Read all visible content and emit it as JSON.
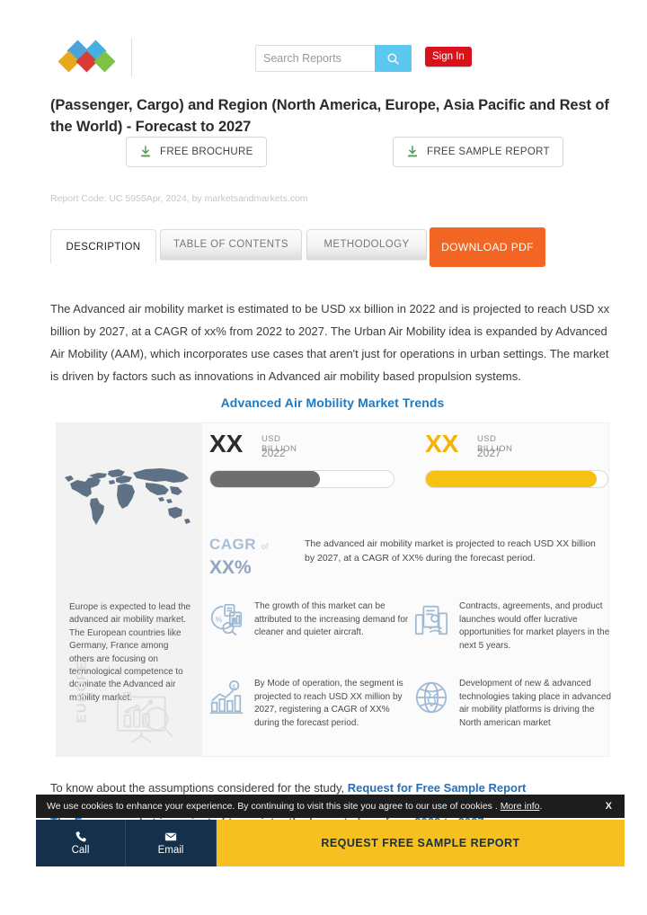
{
  "header": {
    "logo_name": "marketsandmarkets-logo",
    "logo_colors": [
      "#4aa3dd",
      "#45b0e3",
      "#e8a81c",
      "#d93b35",
      "#7dc242"
    ],
    "search": {
      "placeholder": "Search Reports",
      "value": "",
      "button_icon": "search-icon",
      "button_color": "#5bc8ef"
    },
    "sign_in_label": "Sign In",
    "sign_in_color": "#d9111a"
  },
  "title": "(Passenger, Cargo) and Region (North America, Europe, Asia Pacific and Rest of the World) - Forecast to 2027",
  "cta": {
    "brochure_label": "FREE BROCHURE",
    "sample_label": "FREE SAMPLE REPORT",
    "icon": "download-icon",
    "icon_color": "#4f9b52"
  },
  "meta_line": "Report Code: UC 5955Apr, 2024, by marketsandmarkets.com",
  "tabs": [
    {
      "label": "DESCRIPTION",
      "active": true
    },
    {
      "label": "TABLE OF CONTENTS",
      "active": false
    },
    {
      "label": "METHODOLOGY",
      "active": false
    }
  ],
  "download_pdf_label": "DOWNLOAD PDF",
  "download_pdf_color": "#f26522",
  "intro_paragraph": "The Advanced air mobility market is estimated to be USD xx billion in 2022 and is projected to reach USD xx billion by 2027, at a CAGR of xx% from 2022 to 2027. The Urban Air Mobility idea is expanded by Advanced Air Mobility (AAM), which incorporates use cases that aren't just for operations in urban settings. The market is driven by factors such as innovations in Advanced air mobility based propulsion systems.",
  "infographic": {
    "title": "Advanced Air Mobility Market Trends",
    "title_color": "#1f7ac0",
    "map_icon": "world-map-icon",
    "europe_note": "Europe is expected to lead the advanced air mobility market. The European countries like Germany, France among others are focusing on technological competence to dominate the Advanced air mobility market.",
    "europe_watermark": "EUROPE",
    "europe_icon": "chart-presentation-magnifier-icon",
    "figures": [
      {
        "value": "XX",
        "unit": "USD BILLION",
        "year": "2022",
        "bar_fill_percent": 60,
        "color": "#2c2c2c",
        "bar_color": "#6e6e6e"
      },
      {
        "value": "XX",
        "unit": "USD BILLION",
        "year": "2027",
        "bar_fill_percent": 94,
        "color": "#f5b301",
        "bar_color": "#f8c112"
      }
    ],
    "cagr": {
      "label": "CAGR",
      "of": "of",
      "value": "XX%",
      "text": "The advanced air mobility market is projected to reach USD XX billion by 2027, at a CAGR of XX% during the forecast period."
    },
    "cards": [
      {
        "icon": "pie-chart-analysis-icon",
        "text": "The growth of this market can be attributed to the increasing demand for cleaner and quieter aircraft."
      },
      {
        "icon": "contract-handshake-icon",
        "text": "Contracts, agreements, and product launches would offer lucrative opportunities for market players in the next 5 years."
      },
      {
        "icon": "bar-chart-growth-icon",
        "text": "By Mode of operation, the segment is projected to reach USD XX million by 2027, registering a CAGR of XX% during the forecast period."
      },
      {
        "icon": "globe-icon",
        "text": "Development of new & advanced technologies taking place in advanced air mobility platforms is driving the North american market"
      }
    ]
  },
  "know_line": {
    "prefix": "To know about the assumptions considered for the study, ",
    "link": "Request for Free Sample Report"
  },
  "hidden_line": {
    "prefix": "The Europe market is projected to register the largest share from 2022 to 2027",
    "link": ""
  },
  "cookie": {
    "text": "We use cookies to enhance your experience. By continuing to visit this site you agree to our use of cookies .",
    "more_label": "More info",
    "suffix": ".",
    "close_label": "X"
  },
  "footer": {
    "call_label": "Call",
    "call_icon": "phone-icon",
    "email_label": "Email",
    "email_icon": "envelope-icon",
    "cta_label": "REQUEST FREE SAMPLE REPORT",
    "cta_color": "#f5c020",
    "bar_color": "#15304a"
  }
}
